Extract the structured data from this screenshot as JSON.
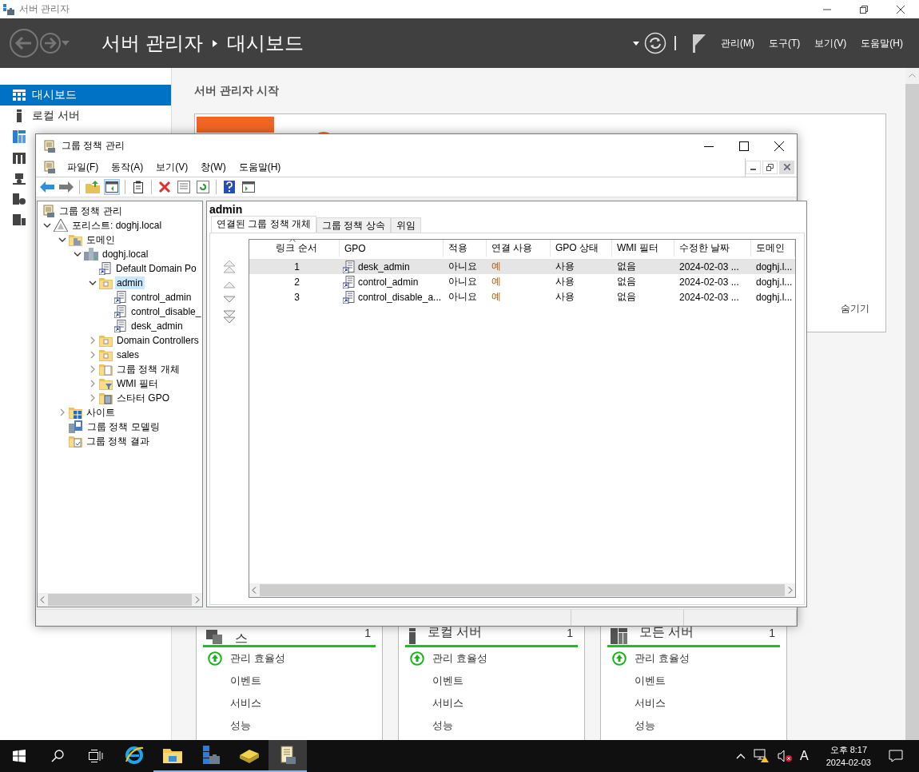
{
  "server_manager": {
    "title": "서버 관리자",
    "breadcrumb": [
      "서버 관리자",
      "대시보드"
    ],
    "menus": [
      "관리(M)",
      "도구(T)",
      "보기(V)",
      "도움말(H)"
    ],
    "sidebar": {
      "items": [
        {
          "label": "대시보드",
          "selected": true
        },
        {
          "label": "로컬 서버",
          "selected": false
        }
      ]
    },
    "welcome": {
      "heading": "서버 관리자 시작",
      "hide_link": "숨기기"
    },
    "tiles": [
      {
        "kind": "storage",
        "title": "스",
        "count": "1",
        "items": [
          {
            "label": "관리 효율성",
            "ok": true
          },
          {
            "label": "이벤트",
            "ok": false
          },
          {
            "label": "서비스",
            "ok": false
          },
          {
            "label": "성능",
            "ok": false
          }
        ]
      },
      {
        "kind": "local",
        "title": "로컬 서버",
        "count": "1",
        "items": [
          {
            "label": "관리 효율성",
            "ok": true
          },
          {
            "label": "이벤트",
            "ok": false
          },
          {
            "label": "서비스",
            "ok": false
          },
          {
            "label": "성능",
            "ok": false
          }
        ]
      },
      {
        "kind": "all",
        "title": "모든 서버",
        "count": "1",
        "items": [
          {
            "label": "관리 효율성",
            "ok": true
          },
          {
            "label": "이벤트",
            "ok": false
          },
          {
            "label": "서비스",
            "ok": false
          },
          {
            "label": "성능",
            "ok": false
          }
        ]
      }
    ]
  },
  "gpmc": {
    "title": "그룹 정책 관리",
    "menus": [
      "파일(F)",
      "동작(A)",
      "보기(V)",
      "창(W)",
      "도움말(H)"
    ],
    "tree": [
      {
        "label": "그룹 정책 관리",
        "kind": "root",
        "selected": false,
        "children": [
          {
            "label": "포리스트: doghj.local",
            "kind": "forest",
            "expanded": true,
            "selected": false,
            "children": [
              {
                "label": "도메인",
                "kind": "domains",
                "expanded": true,
                "selected": false,
                "children": [
                  {
                    "label": "doghj.local",
                    "kind": "domain",
                    "expanded": true,
                    "selected": false,
                    "children": [
                      {
                        "label": "Default Domain Po",
                        "kind": "gpo",
                        "selected": false
                      },
                      {
                        "label": "admin",
                        "kind": "ou",
                        "expanded": true,
                        "selected": true,
                        "children": [
                          {
                            "label": "control_admin",
                            "kind": "gpo",
                            "selected": false
                          },
                          {
                            "label": "control_disable_",
                            "kind": "gpo",
                            "selected": false
                          },
                          {
                            "label": "desk_admin",
                            "kind": "gpo",
                            "selected": false
                          }
                        ]
                      },
                      {
                        "label": "Domain Controllers",
                        "kind": "ou",
                        "expanded": false,
                        "selected": false
                      },
                      {
                        "label": "sales",
                        "kind": "ou",
                        "expanded": false,
                        "selected": false
                      },
                      {
                        "label": "그룹 정책 개체",
                        "kind": "gpo_folder",
                        "expanded": false,
                        "selected": false
                      },
                      {
                        "label": "WMI 필터",
                        "kind": "wmi",
                        "expanded": false,
                        "selected": false
                      },
                      {
                        "label": "스타터 GPO",
                        "kind": "starter",
                        "expanded": false,
                        "selected": false
                      }
                    ]
                  }
                ]
              },
              {
                "label": "사이트",
                "kind": "sites",
                "expanded": false,
                "selected": false
              },
              {
                "label": "그룹 정책 모델링",
                "kind": "modeling",
                "selected": false
              },
              {
                "label": "그룹 정책 결과",
                "kind": "results",
                "selected": false
              }
            ]
          }
        ]
      }
    ],
    "detail": {
      "heading": "admin",
      "tabs": [
        {
          "label": "연결된 그룹 정책 개체",
          "selected": true
        },
        {
          "label": "그룹 정책 상속",
          "selected": false
        },
        {
          "label": "위임",
          "selected": false
        }
      ],
      "table": {
        "columns": [
          "링크 순서",
          "GPO",
          "적용",
          "연결 사용",
          "GPO 상태",
          "WMI 필터",
          "수정한 날짜",
          "도메인"
        ],
        "rows": [
          {
            "selected": true,
            "cells": [
              "1",
              "desk_admin",
              "아니요",
              "예",
              "사용",
              "없음",
              "2024-02-03 ...",
              "doghj.l..."
            ]
          },
          {
            "selected": false,
            "cells": [
              "2",
              "control_admin",
              "아니요",
              "예",
              "사용",
              "없음",
              "2024-02-03 ...",
              "doghj.l..."
            ]
          },
          {
            "selected": false,
            "cells": [
              "3",
              "control_disable_a...",
              "아니요",
              "예",
              "사용",
              "없음",
              "2024-02-03 ...",
              "doghj.l..."
            ]
          }
        ]
      }
    }
  },
  "taskbar": {
    "apps": [
      {
        "kind": "ie",
        "running": false,
        "active": false
      },
      {
        "kind": "explorer",
        "running": true,
        "active": false
      },
      {
        "kind": "server_manager",
        "running": true,
        "active": false
      },
      {
        "kind": "tool",
        "running": true,
        "active": false
      },
      {
        "kind": "gpmc",
        "running": true,
        "active": true
      }
    ],
    "ime": "A",
    "time": "오후 8:17",
    "date": "2024-02-03"
  }
}
